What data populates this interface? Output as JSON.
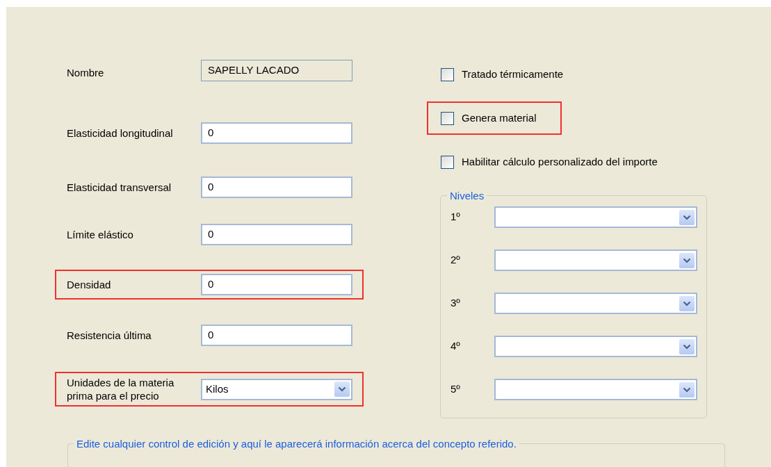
{
  "fields": [
    {
      "kind": "readonly",
      "label": "Nombre",
      "value": "SAPELLY LACADO",
      "highlighted": false
    },
    {
      "kind": "text",
      "label": "Elasticidad longitudinal",
      "value": "0",
      "highlighted": false
    },
    {
      "kind": "text",
      "label": "Elasticidad transversal",
      "value": "0",
      "highlighted": false
    },
    {
      "kind": "text",
      "label": "Límite elástico",
      "value": "0",
      "highlighted": false
    },
    {
      "kind": "text",
      "label": "Densidad",
      "value": "0",
      "highlighted": true
    },
    {
      "kind": "text",
      "label": "Resistencia última",
      "value": "0",
      "highlighted": false
    },
    {
      "kind": "dropdown",
      "label": "Unidades de la materia prima para el precio",
      "value": "Kilos",
      "highlighted": true
    }
  ],
  "options": [
    {
      "label": "Tratado térmicamente",
      "checked": false,
      "highlighted": false
    },
    {
      "label": "Genera material",
      "checked": false,
      "highlighted": true
    },
    {
      "label": "Habilitar cálculo personalizado del importe",
      "checked": false,
      "highlighted": false
    }
  ],
  "levels_group": {
    "title": "Niveles",
    "levels": [
      {
        "label": "1º"
      },
      {
        "label": "2º"
      },
      {
        "label": "3º"
      },
      {
        "label": "4º"
      },
      {
        "label": "5º"
      }
    ]
  },
  "info_group": {
    "title": "Edite cualquier control de edición y aquí le aparecerá información acerca del concepto referido."
  }
}
